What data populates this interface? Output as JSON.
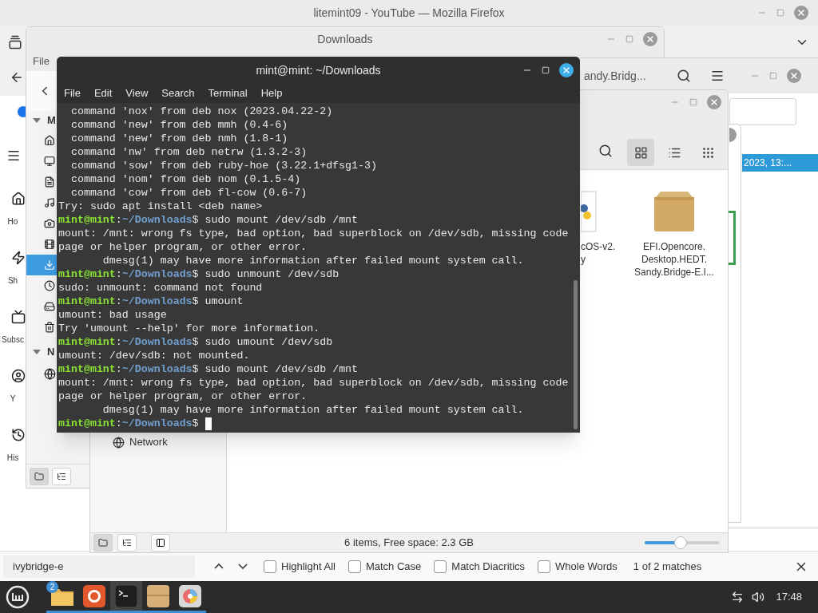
{
  "browser": {
    "title": "litemint09 - YouTube — Mozilla Firefox",
    "sidebar_labels": [
      {
        "kind": "home",
        "label": "Ho"
      },
      {
        "kind": "shorts",
        "label": "Sh"
      },
      {
        "kind": "subscriptions",
        "label": "Subsc"
      },
      {
        "kind": "you",
        "label": "Y"
      },
      {
        "kind": "history",
        "label": "His"
      }
    ],
    "find_bar": {
      "value": "ivybridge-e",
      "options": [
        {
          "label": "Highlight All",
          "checked": false
        },
        {
          "label": "Match Case",
          "checked": false
        },
        {
          "label": "Match Diacritics",
          "checked": false
        },
        {
          "label": "Whole Words",
          "checked": false
        }
      ],
      "result": "1 of 2 matches"
    }
  },
  "downloads_window": {
    "title": "Downloads",
    "menu": [
      "File"
    ],
    "sidebar_headers": [
      "M",
      "N"
    ],
    "places": [
      {
        "kind": "home",
        "selected": false
      },
      {
        "kind": "desktop",
        "selected": false
      },
      {
        "kind": "documents",
        "selected": false
      },
      {
        "kind": "music",
        "selected": false
      },
      {
        "kind": "pictures",
        "selected": false
      },
      {
        "kind": "videos",
        "selected": false
      },
      {
        "kind": "downloads",
        "selected": true
      },
      {
        "kind": "recent",
        "selected": false
      },
      {
        "kind": "drive",
        "selected": false
      },
      {
        "kind": "trash",
        "selected": false
      }
    ],
    "network_places": [
      {
        "kind": "network",
        "selected": false
      }
    ],
    "sidebar_modes": [
      {
        "kind": "places",
        "selected": true
      },
      {
        "kind": "tree",
        "selected": false
      }
    ]
  },
  "back_window": {
    "title": "andy.Bridg...",
    "rows": [
      {
        "text": "2023, 13:...",
        "selected": true
      }
    ]
  },
  "file_window": {
    "sidebar_items": [
      {
        "label": "Network"
      }
    ],
    "view_modes": [
      {
        "kind": "icons",
        "selected": true
      },
      {
        "kind": "list",
        "selected": false
      },
      {
        "kind": "compact",
        "selected": false
      }
    ],
    "files": [
      {
        "kind": "script",
        "name_lines": [
          "cOS-v2.",
          "y"
        ]
      },
      {
        "kind": "archive",
        "name_lines": [
          "EFI.Opencore.",
          "Desktop.HEDT.",
          "Sandy.Bridge-E.I..."
        ]
      }
    ],
    "sidebar_modes": [
      {
        "kind": "places",
        "selected": true
      },
      {
        "kind": "tree",
        "selected": false
      }
    ],
    "status": "6 items, Free space: 2.3 GB",
    "zoom": {
      "level": 0.48
    }
  },
  "terminal": {
    "title": "mint@mint: ~/Downloads",
    "menu": [
      "File",
      "Edit",
      "View",
      "Search",
      "Terminal",
      "Help"
    ],
    "lines": [
      {
        "kind": "out",
        "text": "  command 'nox' from deb nox (2023.04.22-2)"
      },
      {
        "kind": "out",
        "text": "  command 'new' from deb mmh (0.4-6)"
      },
      {
        "kind": "out",
        "text": "  command 'new' from deb nmh (1.8-1)"
      },
      {
        "kind": "out",
        "text": "  command 'nw' from deb netrw (1.3.2-3)"
      },
      {
        "kind": "out",
        "text": "  command 'sow' from deb ruby-hoe (3.22.1+dfsg1-3)"
      },
      {
        "kind": "out",
        "text": "  command 'nom' from deb nom (0.1.5-4)"
      },
      {
        "kind": "out",
        "text": "  command 'cow' from deb fl-cow (0.6-7)"
      },
      {
        "kind": "out",
        "text": "Try: sudo apt install <deb name>"
      },
      {
        "kind": "prompt",
        "user": "mint@mint",
        "separator": ":",
        "path": "~/Downloads",
        "symbol": "$",
        "command": "sudo mount /dev/sdb /mnt"
      },
      {
        "kind": "out",
        "text": "mount: /mnt: wrong fs type, bad option, bad superblock on /dev/sdb, missing code"
      },
      {
        "kind": "out",
        "text": "page or helper program, or other error."
      },
      {
        "kind": "out",
        "text": "       dmesg(1) may have more information after failed mount system call."
      },
      {
        "kind": "prompt",
        "user": "mint@mint",
        "separator": ":",
        "path": "~/Downloads",
        "symbol": "$",
        "command": "sudo unmount /dev/sdb"
      },
      {
        "kind": "out",
        "text": "sudo: unmount: command not found"
      },
      {
        "kind": "prompt",
        "user": "mint@mint",
        "separator": ":",
        "path": "~/Downloads",
        "symbol": "$",
        "command": "umount"
      },
      {
        "kind": "out",
        "text": "umount: bad usage"
      },
      {
        "kind": "out",
        "text": "Try 'umount --help' for more information."
      },
      {
        "kind": "prompt",
        "user": "mint@mint",
        "separator": ":",
        "path": "~/Downloads",
        "symbol": "$",
        "command": "sudo umount /dev/sdb"
      },
      {
        "kind": "out",
        "text": "umount: /dev/sdb: not mounted."
      },
      {
        "kind": "prompt",
        "user": "mint@mint",
        "separator": ":",
        "path": "~/Downloads",
        "symbol": "$",
        "command": "sudo mount /dev/sdb /mnt"
      },
      {
        "kind": "out",
        "text": "mount: /mnt: wrong fs type, bad option, bad superblock on /dev/sdb, missing code"
      },
      {
        "kind": "out",
        "text": "page or helper program, or other error."
      },
      {
        "kind": "out",
        "text": "       dmesg(1) may have more information after failed mount system call."
      },
      {
        "kind": "prompt",
        "user": "mint@mint",
        "separator": ":",
        "path": "~/Downloads",
        "symbol": "$",
        "cursor": true
      }
    ]
  },
  "taskbar": {
    "apps": [
      {
        "kind": "files",
        "badge": "2",
        "running": true,
        "active": false
      },
      {
        "kind": "firefox",
        "running": true,
        "active": false
      },
      {
        "kind": "terminal",
        "running": true,
        "active": true
      },
      {
        "kind": "archive",
        "running": true,
        "active": false
      },
      {
        "kind": "colors",
        "running": true,
        "active": false
      }
    ],
    "clock": "17:48"
  }
}
